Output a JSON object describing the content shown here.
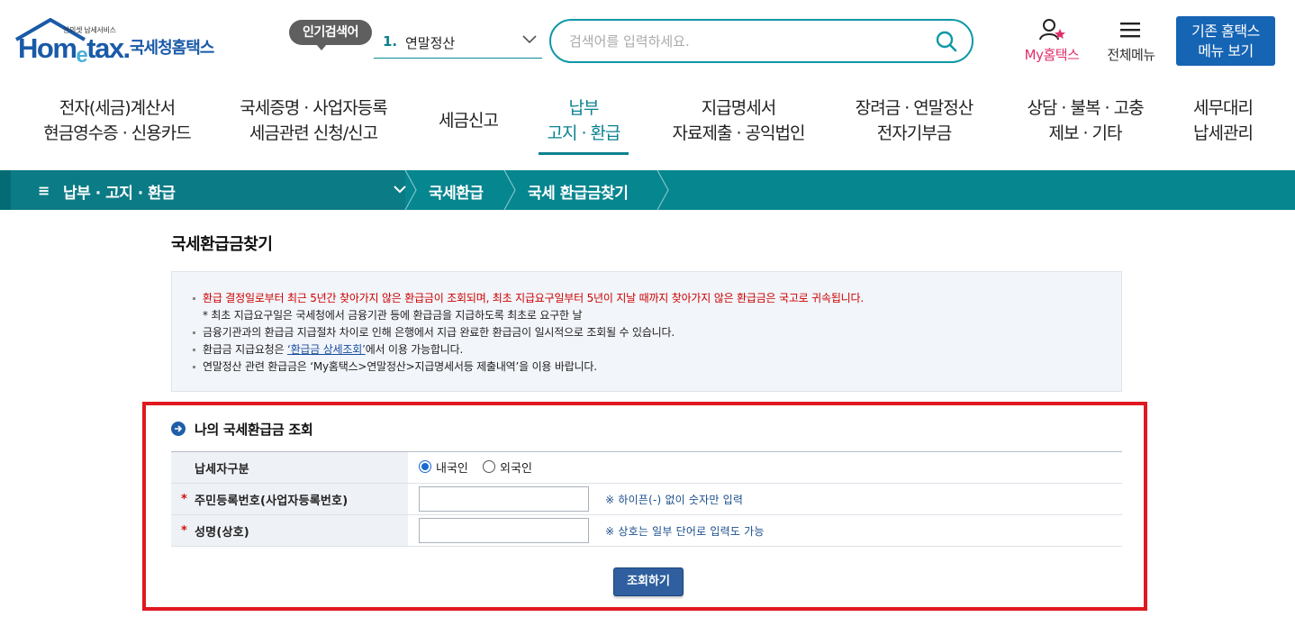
{
  "header": {
    "logo": {
      "caption": "안의셋 납세서비스",
      "brand_en_1": "Hom",
      "brand_en_2": "e",
      "brand_en_3": "tax.",
      "brand_ko": "국세청홈택스"
    },
    "hot_keyword_badge": "인기검색어",
    "hot_keyword": {
      "rank": "1.",
      "keyword": "연말정산"
    },
    "search": {
      "placeholder": "검색어를 입력하세요.",
      "value": ""
    },
    "my_hometax": "My홈택스",
    "all_menu": "전체메뉴",
    "old_menu": {
      "line1": "기존 홈택스",
      "line2": "메뉴 보기"
    }
  },
  "gnb": [
    {
      "line1": "전자(세금)계산서",
      "line2": "현금영수증 · 신용카드"
    },
    {
      "line1": "국세증명 · 사업자등록",
      "line2": "세금관련 신청/신고"
    },
    {
      "line1": "세금신고",
      "line2": ""
    },
    {
      "line1": "납부",
      "line2": "고지 · 환급"
    },
    {
      "line1": "지급명세서",
      "line2": "자료제출 · 공익법인"
    },
    {
      "line1": "장려금 · 연말정산",
      "line2": "전자기부금"
    },
    {
      "line1": "상담 · 불복 · 고충",
      "line2": "제보 · 기타"
    },
    {
      "line1": "세무대리",
      "line2": "납세관리"
    }
  ],
  "location": {
    "depth1": "납부 · 고지 · 환급",
    "depth2": "국세환급",
    "depth3": "국세 환급금찾기"
  },
  "page_title": "국세환급금찾기",
  "notice": {
    "item1": "환급 결정일로부터 최근 5년간 찾아가지 않은 환급금이 조회되며, 최초 지급요구일부터 5년이 지날 때까지 찾아가지 않은 환급금은 국고로 귀속됩니다.",
    "item1_sub": "* 최초 지급요구일은 국세청에서 금융기관 등에 환급금을 지급하도록 최초로 요구한 날",
    "item2": "금융기관과의 환급금 지급절차 차이로 인해 은행에서 지급 완료한 환급금이 일시적으로 조회될 수 있습니다.",
    "item3_pre": "환급금 지급요청은 ",
    "item3_link": "‘환급금 상세조회’",
    "item3_post": "에서 이용 가능합니다.",
    "item4": "연말정산 관련 환급금은 ‘My홈택스>연말정산>지급명세서등 제출내역’을 이용 바랍니다."
  },
  "form": {
    "section_title": "나의 국세환급금 조회",
    "taxpayer_type": {
      "label": "납세자구분",
      "options": [
        "내국인",
        "외국인"
      ],
      "selected": "내국인"
    },
    "resident_no": {
      "label": "주민등록번호(사업자등록번호)",
      "required_mark": "*",
      "value": "",
      "hint": "※ 하이픈(-) 없이 숫자만 입력"
    },
    "name": {
      "label": "성명(상호)",
      "required_mark": "*",
      "value": "",
      "hint": "※ 상호는 일부 단어로 입력도 가능"
    },
    "submit_label": "조회하기"
  },
  "colors": {
    "teal": "#06868f",
    "brand_blue": "#1a5aa8",
    "button_blue": "#2f5f9e",
    "highlight_red": "#e0181f",
    "notice_red": "#cc0000"
  }
}
